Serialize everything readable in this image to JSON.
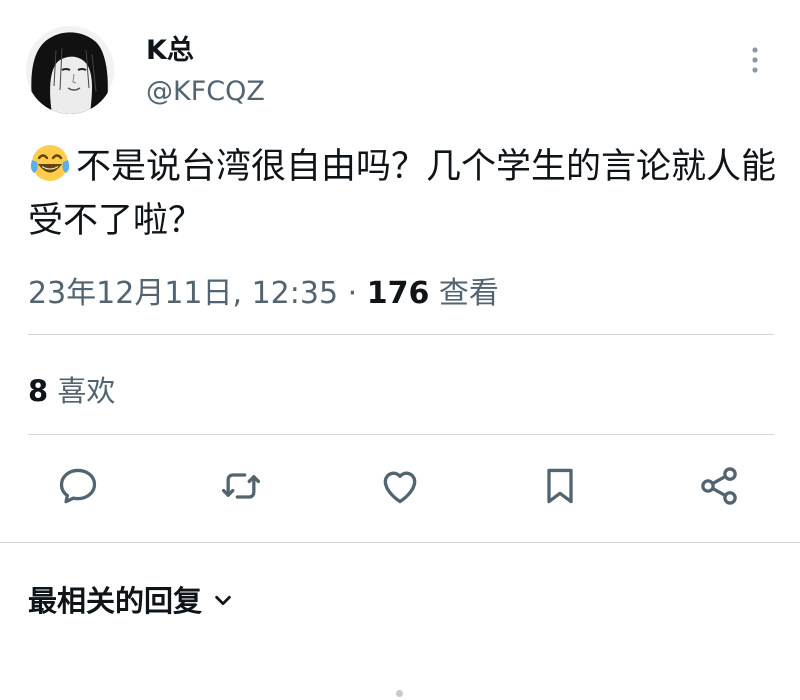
{
  "author": {
    "display_name": "K总",
    "handle": "@KFCQZ"
  },
  "tweet": {
    "emoji": "face-with-tears-of-joy",
    "text": "不是说台湾很自由吗？几个学生的言论就人能受不了啦？"
  },
  "meta": {
    "timestamp": "23年12月11日, 12:35",
    "separator": "·",
    "views_count": "176",
    "views_label": "查看"
  },
  "likes": {
    "count": "8",
    "label": "喜欢"
  },
  "replies": {
    "sort_label": "最相关的回复"
  },
  "icons": {
    "more": "more-vertical-icon",
    "reply": "reply-icon",
    "retweet": "retweet-icon",
    "like": "heart-icon",
    "bookmark": "bookmark-icon",
    "share": "share-icon",
    "chevron": "chevron-down-icon"
  },
  "colors": {
    "text_primary": "#0f1419",
    "text_secondary": "#536471",
    "icon": "#536471",
    "divider": "#cfd9de"
  }
}
